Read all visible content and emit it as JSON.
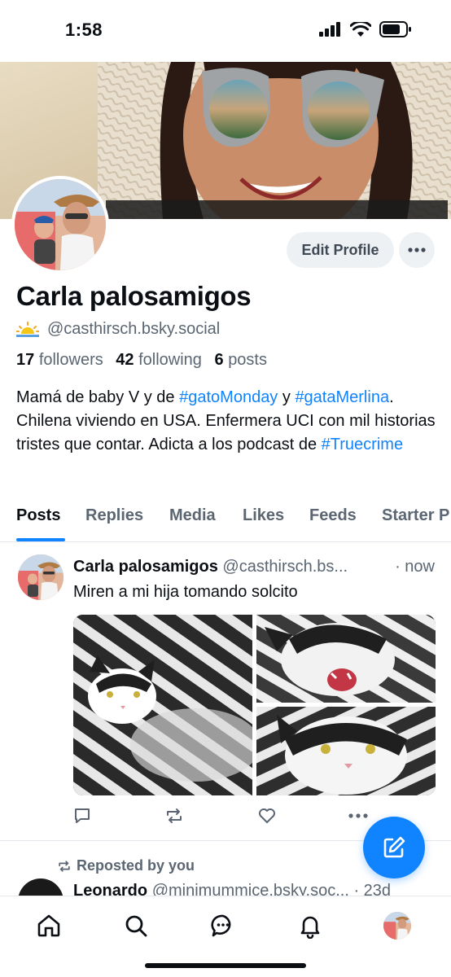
{
  "status_bar": {
    "time": "1:58"
  },
  "profile": {
    "display_name": "Carla palosamigos",
    "handle": "@casthirsch.bsky.social",
    "edit_label": "Edit Profile",
    "stats": {
      "followers_count": "17",
      "followers_label": "followers",
      "following_count": "42",
      "following_label": "following",
      "posts_count": "6",
      "posts_label": "posts"
    },
    "bio": {
      "p1": "Mamá de baby V y de ",
      "tag1": "#gatoMonday",
      "p2": " y ",
      "tag2": "#gataMerlina",
      "p3": ". Chilena viviendo en USA. Enfermera UCI con mil historias tristes que contar. Adicta a los podcast de ",
      "tag3": "#Truecrime"
    }
  },
  "tabs": [
    "Posts",
    "Replies",
    "Media",
    "Likes",
    "Feeds",
    "Starter P"
  ],
  "post": {
    "author": "Carla palosamigos",
    "handle": "@casthirsch.bs...",
    "time": "· now",
    "text": "Miren a mi hija tomando solcito"
  },
  "repost": {
    "label": "Reposted by you",
    "author": "Leonardo",
    "handle": "@minimummice.bsky.soc...",
    "time": "· 23d"
  },
  "colors": {
    "accent": "#1083fe",
    "muted": "#5b6672",
    "text": "#0b0f14"
  }
}
